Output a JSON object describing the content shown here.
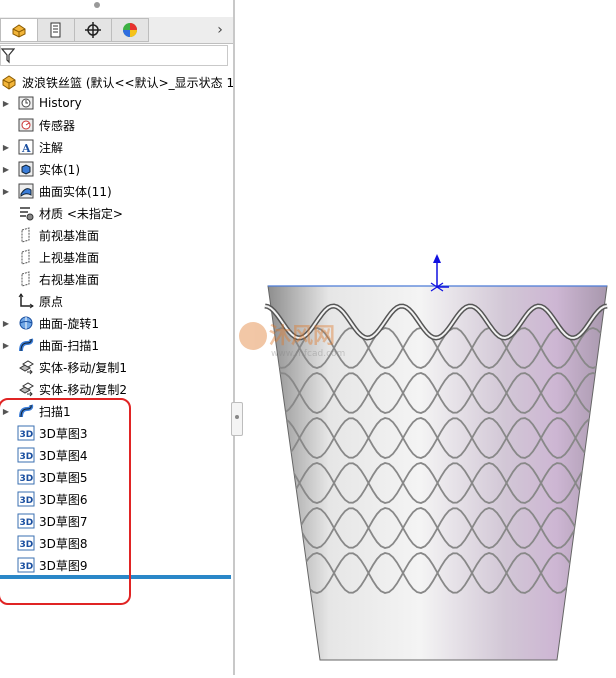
{
  "feature_manager": {
    "root_label": "波浪铁丝篮  (默认<<默认>_显示状态 1",
    "items": [
      {
        "label": "History",
        "icon": "history-icon",
        "expandable": true
      },
      {
        "label": "传感器",
        "icon": "sensor-icon",
        "expandable": false
      },
      {
        "label": "注解",
        "icon": "annotation-icon",
        "expandable": true
      },
      {
        "label": "实体(1)",
        "icon": "solid-bodies-icon",
        "expandable": true
      },
      {
        "label": "曲面实体(11)",
        "icon": "surface-bodies-icon",
        "expandable": true
      },
      {
        "label": "材质 <未指定>",
        "icon": "material-icon",
        "expandable": false
      },
      {
        "label": "前视基准面",
        "icon": "plane-icon",
        "expandable": false
      },
      {
        "label": "上视基准面",
        "icon": "plane-icon",
        "expandable": false
      },
      {
        "label": "右视基准面",
        "icon": "plane-icon",
        "expandable": false
      },
      {
        "label": "原点",
        "icon": "origin-icon",
        "expandable": false
      },
      {
        "label": "曲面-旋转1",
        "icon": "revolve-surface-icon",
        "expandable": true
      },
      {
        "label": "曲面-扫描1",
        "icon": "sweep-surface-icon",
        "expandable": true
      },
      {
        "label": "实体-移动/复制1",
        "icon": "move-copy-body-icon",
        "expandable": false
      },
      {
        "label": "实体-移动/复制2",
        "icon": "move-copy-body-icon",
        "expandable": false
      },
      {
        "label": "扫描1",
        "icon": "sweep-icon",
        "expandable": true
      },
      {
        "label": "3D草图3",
        "icon": "3d-sketch-icon",
        "expandable": false
      },
      {
        "label": "3D草图4",
        "icon": "3d-sketch-icon",
        "expandable": false
      },
      {
        "label": "3D草图5",
        "icon": "3d-sketch-icon",
        "expandable": false
      },
      {
        "label": "3D草图6",
        "icon": "3d-sketch-icon",
        "expandable": false
      },
      {
        "label": "3D草图7",
        "icon": "3d-sketch-icon",
        "expandable": false
      },
      {
        "label": "3D草图8",
        "icon": "3d-sketch-icon",
        "expandable": false
      },
      {
        "label": "3D草图9",
        "icon": "3d-sketch-icon",
        "expandable": false
      }
    ],
    "tabs": [
      "feature-manager-tab",
      "property-manager-tab",
      "configuration-manager-tab",
      "display-manager-tab"
    ]
  },
  "sketch_badge": "3D",
  "watermark": {
    "logo": "沐风网",
    "url": "www.mfcad.com"
  },
  "colors": {
    "rollback_bar": "#2a87c8",
    "highlight": "#e02424",
    "model_silver": "#c8c8c8",
    "model_tint": "#cdb6d3",
    "wire": "#888888",
    "axis": "#1010e0"
  }
}
